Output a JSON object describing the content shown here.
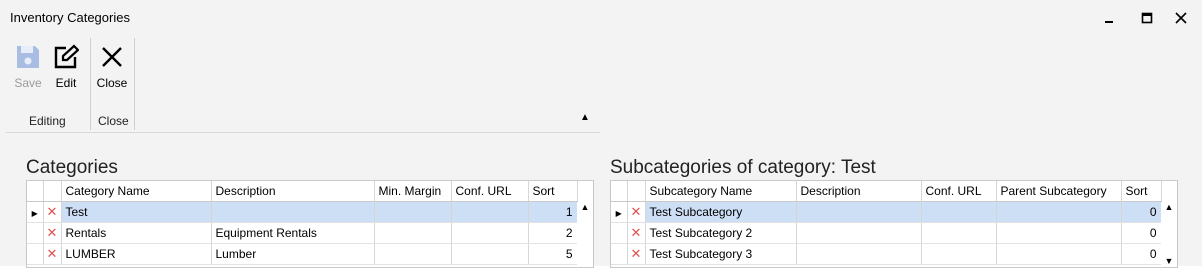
{
  "window": {
    "title": "Inventory Categories"
  },
  "ribbon": {
    "save_label": "Save",
    "edit_label": "Edit",
    "close_label": "Close",
    "group_editing": "Editing",
    "group_close": "Close"
  },
  "categories": {
    "title": "Categories",
    "columns": [
      "Category Name",
      "Description",
      "Min. Margin",
      "Conf. URL",
      "Sort"
    ],
    "rows": [
      {
        "name": "Test",
        "description": "",
        "min_margin": "",
        "conf_url": "",
        "sort": "1",
        "selected": true
      },
      {
        "name": "Rentals",
        "description": "Equipment Rentals",
        "min_margin": "",
        "conf_url": "",
        "sort": "2",
        "selected": false
      },
      {
        "name": "LUMBER",
        "description": "Lumber",
        "min_margin": "",
        "conf_url": "",
        "sort": "5",
        "selected": false
      }
    ]
  },
  "subcategories": {
    "title": "Subcategories of category: Test",
    "columns": [
      "Subcategory Name",
      "Description",
      "Conf. URL",
      "Parent Subcategory",
      "Sort"
    ],
    "rows": [
      {
        "name": "Test Subcategory",
        "description": "",
        "conf_url": "",
        "parent": "",
        "sort": "0",
        "selected": true
      },
      {
        "name": "Test Subcategory 2",
        "description": "",
        "conf_url": "",
        "parent": "",
        "sort": "0",
        "selected": false
      },
      {
        "name": "Test Subcategory 3",
        "description": "",
        "conf_url": "",
        "parent": "",
        "sort": "0",
        "selected": false
      }
    ]
  },
  "colors": {
    "selected_row": "#cddff5",
    "delete_icon": "#e05252",
    "save_icon_disabled": "#a9bde3"
  }
}
